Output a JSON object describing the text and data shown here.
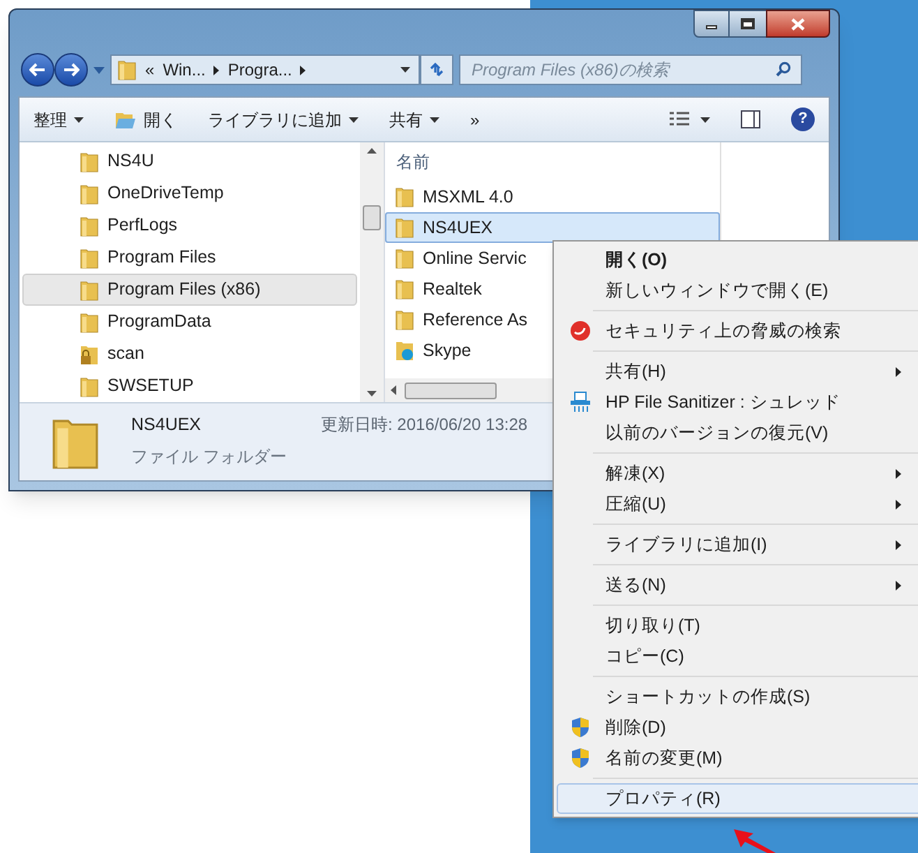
{
  "address": {
    "overflow": "«",
    "crumbs": [
      "Win...",
      "Progra..."
    ]
  },
  "search": {
    "placeholder": "Program Files (x86)の検索"
  },
  "toolbar": [
    {
      "label": "整理",
      "kind": "menu"
    },
    {
      "label": "開く",
      "kind": "open"
    },
    {
      "label": "ライブラリに追加",
      "kind": "menu"
    },
    {
      "label": "共有",
      "kind": "menu"
    },
    {
      "label": "»",
      "kind": "more"
    }
  ],
  "help_label": "?",
  "nav_items": [
    {
      "label": "NS4U",
      "kind": "folder",
      "selected": false
    },
    {
      "label": "OneDriveTemp",
      "kind": "folder",
      "selected": false
    },
    {
      "label": "PerfLogs",
      "kind": "folder",
      "selected": false
    },
    {
      "label": "Program Files",
      "kind": "folder",
      "selected": false
    },
    {
      "label": "Program Files (x86)",
      "kind": "folder",
      "selected": true
    },
    {
      "label": "ProgramData",
      "kind": "folder",
      "selected": false
    },
    {
      "label": "scan",
      "kind": "locked",
      "selected": false
    },
    {
      "label": "SWSETUP",
      "kind": "folder",
      "selected": false
    }
  ],
  "file_list": {
    "column": "名前",
    "rows": [
      {
        "name": "MSXML 4.0",
        "kind": "folder",
        "selected": false
      },
      {
        "name": "NS4UEX",
        "kind": "folder",
        "selected": true
      },
      {
        "name": "Online Servic",
        "kind": "folder",
        "selected": false
      },
      {
        "name": "Realtek",
        "kind": "folder",
        "selected": false
      },
      {
        "name": "Reference As",
        "kind": "folder",
        "selected": false
      },
      {
        "name": "Skype",
        "kind": "skype",
        "selected": false
      }
    ]
  },
  "details": {
    "name": "NS4UEX",
    "modified": "更新日時: 2016/06/20 13:28",
    "type": "ファイル フォルダー"
  },
  "context_menu": [
    {
      "kind": "item",
      "label": "開く(O)",
      "bold": true,
      "submenu": false,
      "selected": false
    },
    {
      "kind": "item",
      "label": "新しいウィンドウで開く(E)",
      "bold": false,
      "submenu": false,
      "selected": false
    },
    {
      "kind": "separator"
    },
    {
      "kind": "scan",
      "label": "セキュリティ上の脅威の検索",
      "bold": false,
      "submenu": false,
      "selected": false
    },
    {
      "kind": "separator"
    },
    {
      "kind": "item",
      "label": "共有(H)",
      "bold": false,
      "submenu": true,
      "selected": false
    },
    {
      "kind": "shredder",
      "label": "HP File Sanitizer : シュレッド",
      "bold": false,
      "submenu": false,
      "selected": false
    },
    {
      "kind": "item",
      "label": "以前のバージョンの復元(V)",
      "bold": false,
      "submenu": false,
      "selected": false
    },
    {
      "kind": "separator"
    },
    {
      "kind": "item",
      "label": "解凍(X)",
      "bold": false,
      "submenu": true,
      "selected": false
    },
    {
      "kind": "item",
      "label": "圧縮(U)",
      "bold": false,
      "submenu": true,
      "selected": false
    },
    {
      "kind": "separator"
    },
    {
      "kind": "item",
      "label": "ライブラリに追加(I)",
      "bold": false,
      "submenu": true,
      "selected": false
    },
    {
      "kind": "separator"
    },
    {
      "kind": "item",
      "label": "送る(N)",
      "bold": false,
      "submenu": true,
      "selected": false
    },
    {
      "kind": "separator"
    },
    {
      "kind": "item",
      "label": "切り取り(T)",
      "bold": false,
      "submenu": false,
      "selected": false
    },
    {
      "kind": "item",
      "label": "コピー(C)",
      "bold": false,
      "submenu": false,
      "selected": false
    },
    {
      "kind": "separator"
    },
    {
      "kind": "item",
      "label": "ショートカットの作成(S)",
      "bold": false,
      "submenu": false,
      "selected": false
    },
    {
      "kind": "shield",
      "label": "削除(D)",
      "bold": false,
      "submenu": false,
      "selected": false
    },
    {
      "kind": "shield",
      "label": "名前の変更(M)",
      "bold": false,
      "submenu": false,
      "selected": false
    },
    {
      "kind": "separator"
    },
    {
      "kind": "item",
      "label": "プロパティ(R)",
      "bold": false,
      "submenu": false,
      "selected": true
    }
  ]
}
